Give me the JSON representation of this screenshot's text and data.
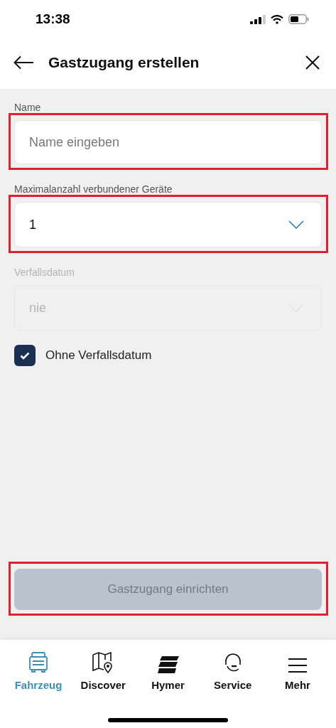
{
  "status_bar": {
    "time": "13:38"
  },
  "header": {
    "title": "Gastzugang erstellen"
  },
  "fields": [
    {
      "kind": "text",
      "label": "Name",
      "placeholder": "Name eingeben",
      "disabled": false,
      "highlighted": true
    },
    {
      "kind": "select",
      "label": "Maximalanzahl verbundener Geräte",
      "value": "1",
      "disabled": false,
      "highlighted": true
    },
    {
      "kind": "select",
      "label": "Verfallsdatum",
      "value": "nie",
      "disabled": true,
      "highlighted": false
    }
  ],
  "checkbox": {
    "label": "Ohne Verfallsdatum",
    "checked": true
  },
  "submit_button": {
    "label": "Gastzugang einrichten",
    "disabled": true,
    "highlighted": true
  },
  "nav": [
    {
      "label": "Fahrzeug",
      "selected": true
    },
    {
      "label": "Discover",
      "selected": false
    },
    {
      "label": "Hymer",
      "selected": false
    },
    {
      "label": "Service",
      "selected": false
    },
    {
      "label": "Mehr",
      "selected": false
    }
  ]
}
